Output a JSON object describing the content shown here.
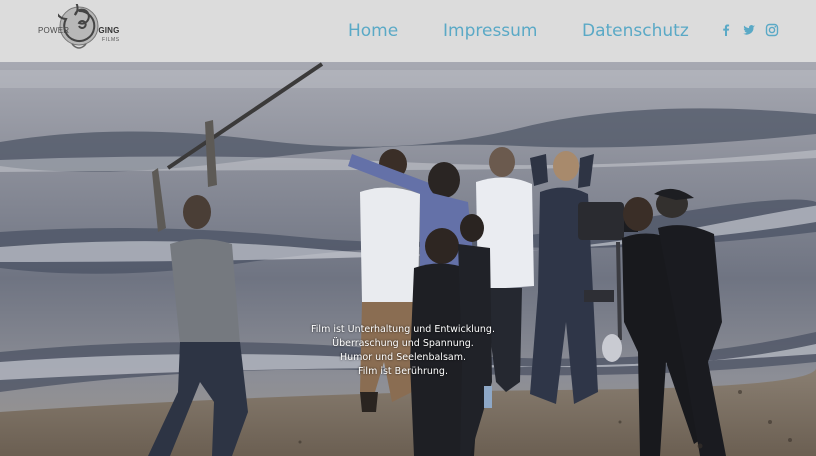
{
  "logo": {
    "wordmark_left": "POWER",
    "wordmark_right": "GING",
    "sub": "FILMS"
  },
  "nav": {
    "home": "Home",
    "impressum": "Impressum",
    "datenschutz": "Datenschutz"
  },
  "social": {
    "facebook": "f",
    "twitter": "🐦",
    "instagram": "◎"
  },
  "hero": {
    "tagline_lines": [
      "Film ist Unterhaltung und Entwicklung.",
      "Überraschung und Spannung.",
      "Humor und Seelenbalsam.",
      "Film ist Berührung."
    ]
  },
  "colors": {
    "nav_accent": "#5aa9c6",
    "header_bg": "#dcdcdc"
  }
}
